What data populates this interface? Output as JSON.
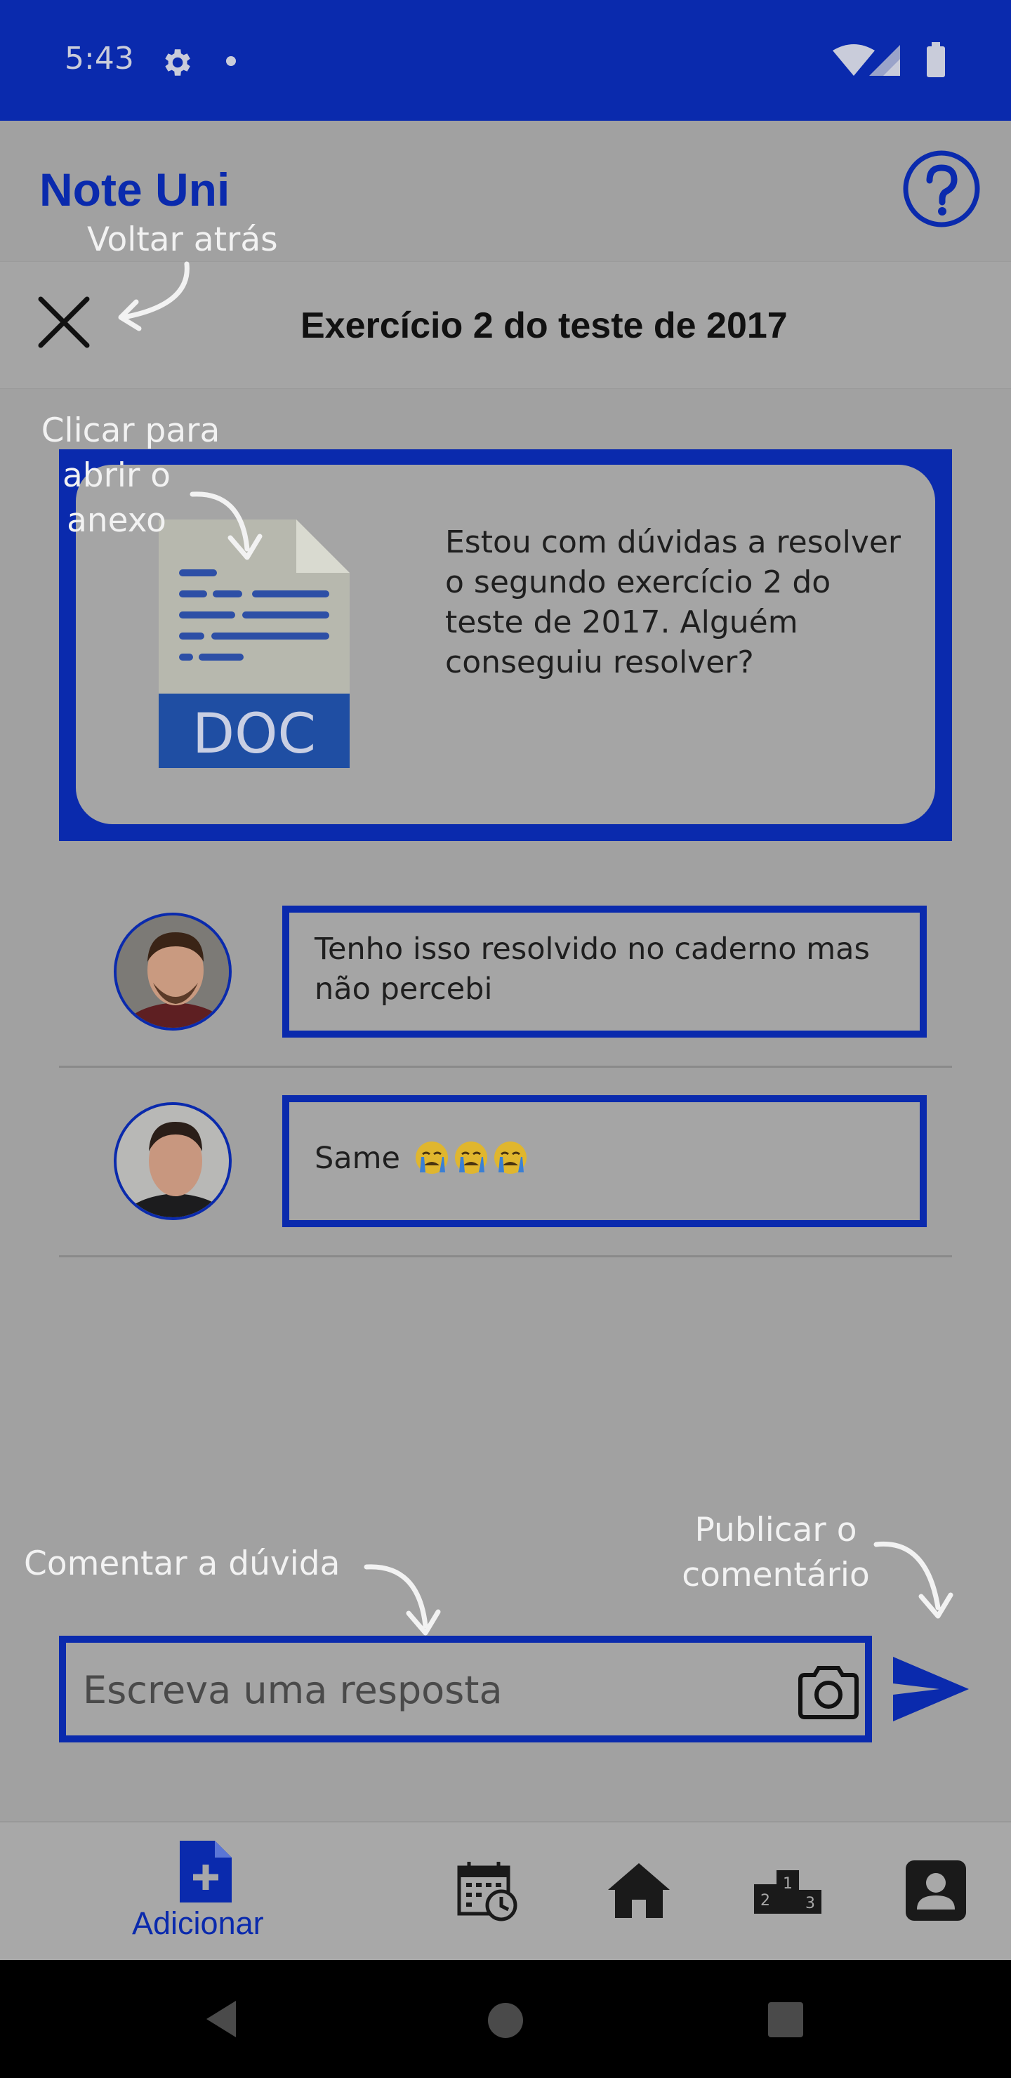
{
  "status_bar": {
    "time": "5:43"
  },
  "header": {
    "app_title": "Note Uni",
    "page_title": "Exercício 2 do teste de 2017"
  },
  "post": {
    "attachment_label": "DOC",
    "text": "Estou com dúvidas a resolver o segundo exercício 2 do teste de 2017. Alguém conseguiu resolver?"
  },
  "comments": [
    {
      "text": "Tenho isso resolvido no caderno mas não percebi"
    },
    {
      "text": "Same"
    }
  ],
  "reply": {
    "placeholder": "Escreva uma resposta"
  },
  "annotations": {
    "back": "Voltar atrás",
    "attachment_line1": "Clicar para",
    "attachment_line2": "abrir o",
    "attachment_line3": "anexo",
    "comment": "Comentar a dúvida",
    "publish_line1": "Publicar o",
    "publish_line2": "comentário"
  },
  "bottom_nav": {
    "add_label": "Adicionar",
    "items": [
      "add-icon",
      "calendar-clock-icon",
      "home-icon",
      "podium-icon",
      "profile-icon"
    ]
  },
  "colors": {
    "primary": "#0a2aad",
    "overlay_background": "#a1a1a1"
  }
}
